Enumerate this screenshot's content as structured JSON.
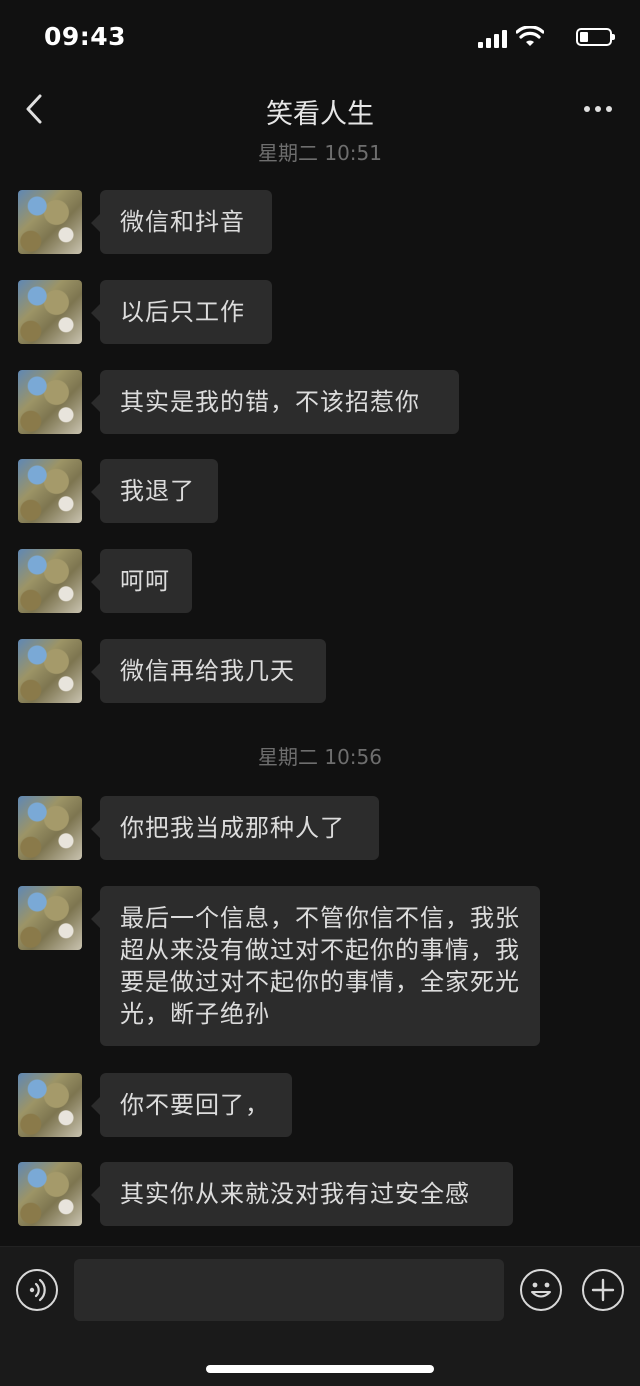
{
  "status_bar": {
    "time": "09:43",
    "icons": [
      "signal-icon",
      "wifi-icon",
      "battery-icon"
    ]
  },
  "nav": {
    "title": "笑看人生",
    "back_icon": "chevron-left-icon",
    "more_icon": "more-dots-icon"
  },
  "chat": {
    "timestamps": [
      "星期二 10:51",
      "星期二 10:56"
    ],
    "messages": [
      "微信和抖音",
      "以后只工作",
      "其实是我的错，不该招惹你",
      "我退了",
      "呵呵",
      "微信再给我几天",
      "你把我当成那种人了",
      "最后一个信息，不管你信不信，我张超从来没有做过对不起你的事情，我要是做过对不起你的事情，全家死光光，断子绝孙",
      "你不要回了，",
      "其实你从来就没对我有过安全感"
    ]
  },
  "input_bar": {
    "text_value": "",
    "voice_icon": "voice-icon",
    "emoji_icon": "emoji-icon",
    "plus_icon": "plus-icon"
  },
  "colors": {
    "background": "#111111",
    "bubble": "#2c2c2c",
    "timestamp": "#6e6e6e"
  }
}
